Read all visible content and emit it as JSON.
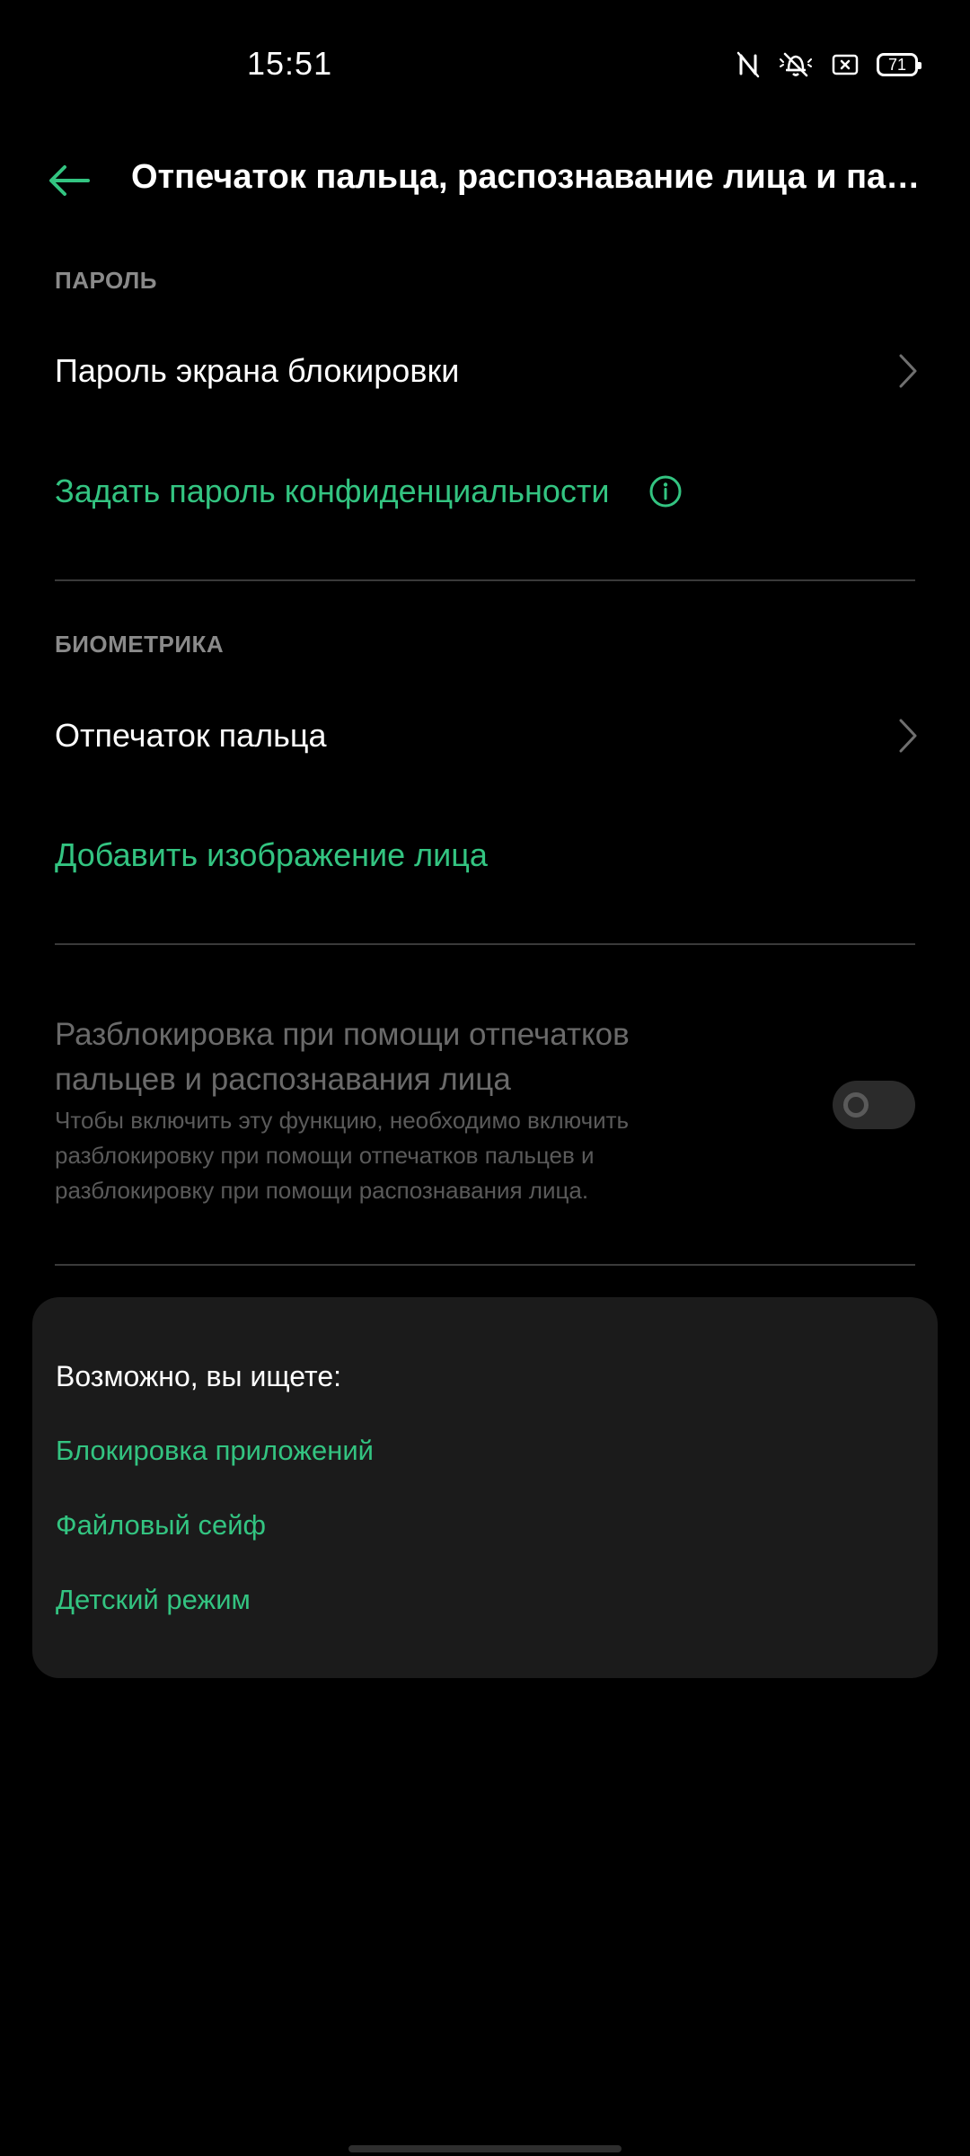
{
  "status_bar": {
    "time": "15:51",
    "battery_level": "71",
    "icons": [
      "nfc-off-icon",
      "bell-off-icon",
      "sim-icon",
      "battery-icon"
    ]
  },
  "app_bar": {
    "back_icon": "arrow-left-icon",
    "title": "Отпечаток пальца, распознавание лица и пароль"
  },
  "sections": {
    "password": {
      "header": "ПАРОЛЬ",
      "lock_screen_password": "Пароль экрана блокировки",
      "privacy_password": "Задать пароль конфиденциальности"
    },
    "biometrics": {
      "header": "БИОМЕТРИКА",
      "fingerprint": "Отпечаток пальца",
      "add_face": "Добавить изображение лица"
    },
    "combined_unlock": {
      "title": "Разблокировка при помощи отпечатков пальцев и распознавания лица",
      "description": "Чтобы включить эту функцию, необходимо включить разблокировку при помощи отпечатков пальцев и разблокировку при помощи распознавания лица.",
      "toggle_state": "off"
    }
  },
  "suggestions": {
    "title": "Возможно, вы ищете:",
    "items": [
      {
        "label": "Блокировка приложений"
      },
      {
        "label": "Файловый сейф"
      },
      {
        "label": "Детский режим"
      }
    ]
  },
  "colors": {
    "accent": "#33c481",
    "background": "#000000",
    "card": "#1b1b1b",
    "divider": "#3a3a3a",
    "disabled_text": "#6a6a6a"
  }
}
